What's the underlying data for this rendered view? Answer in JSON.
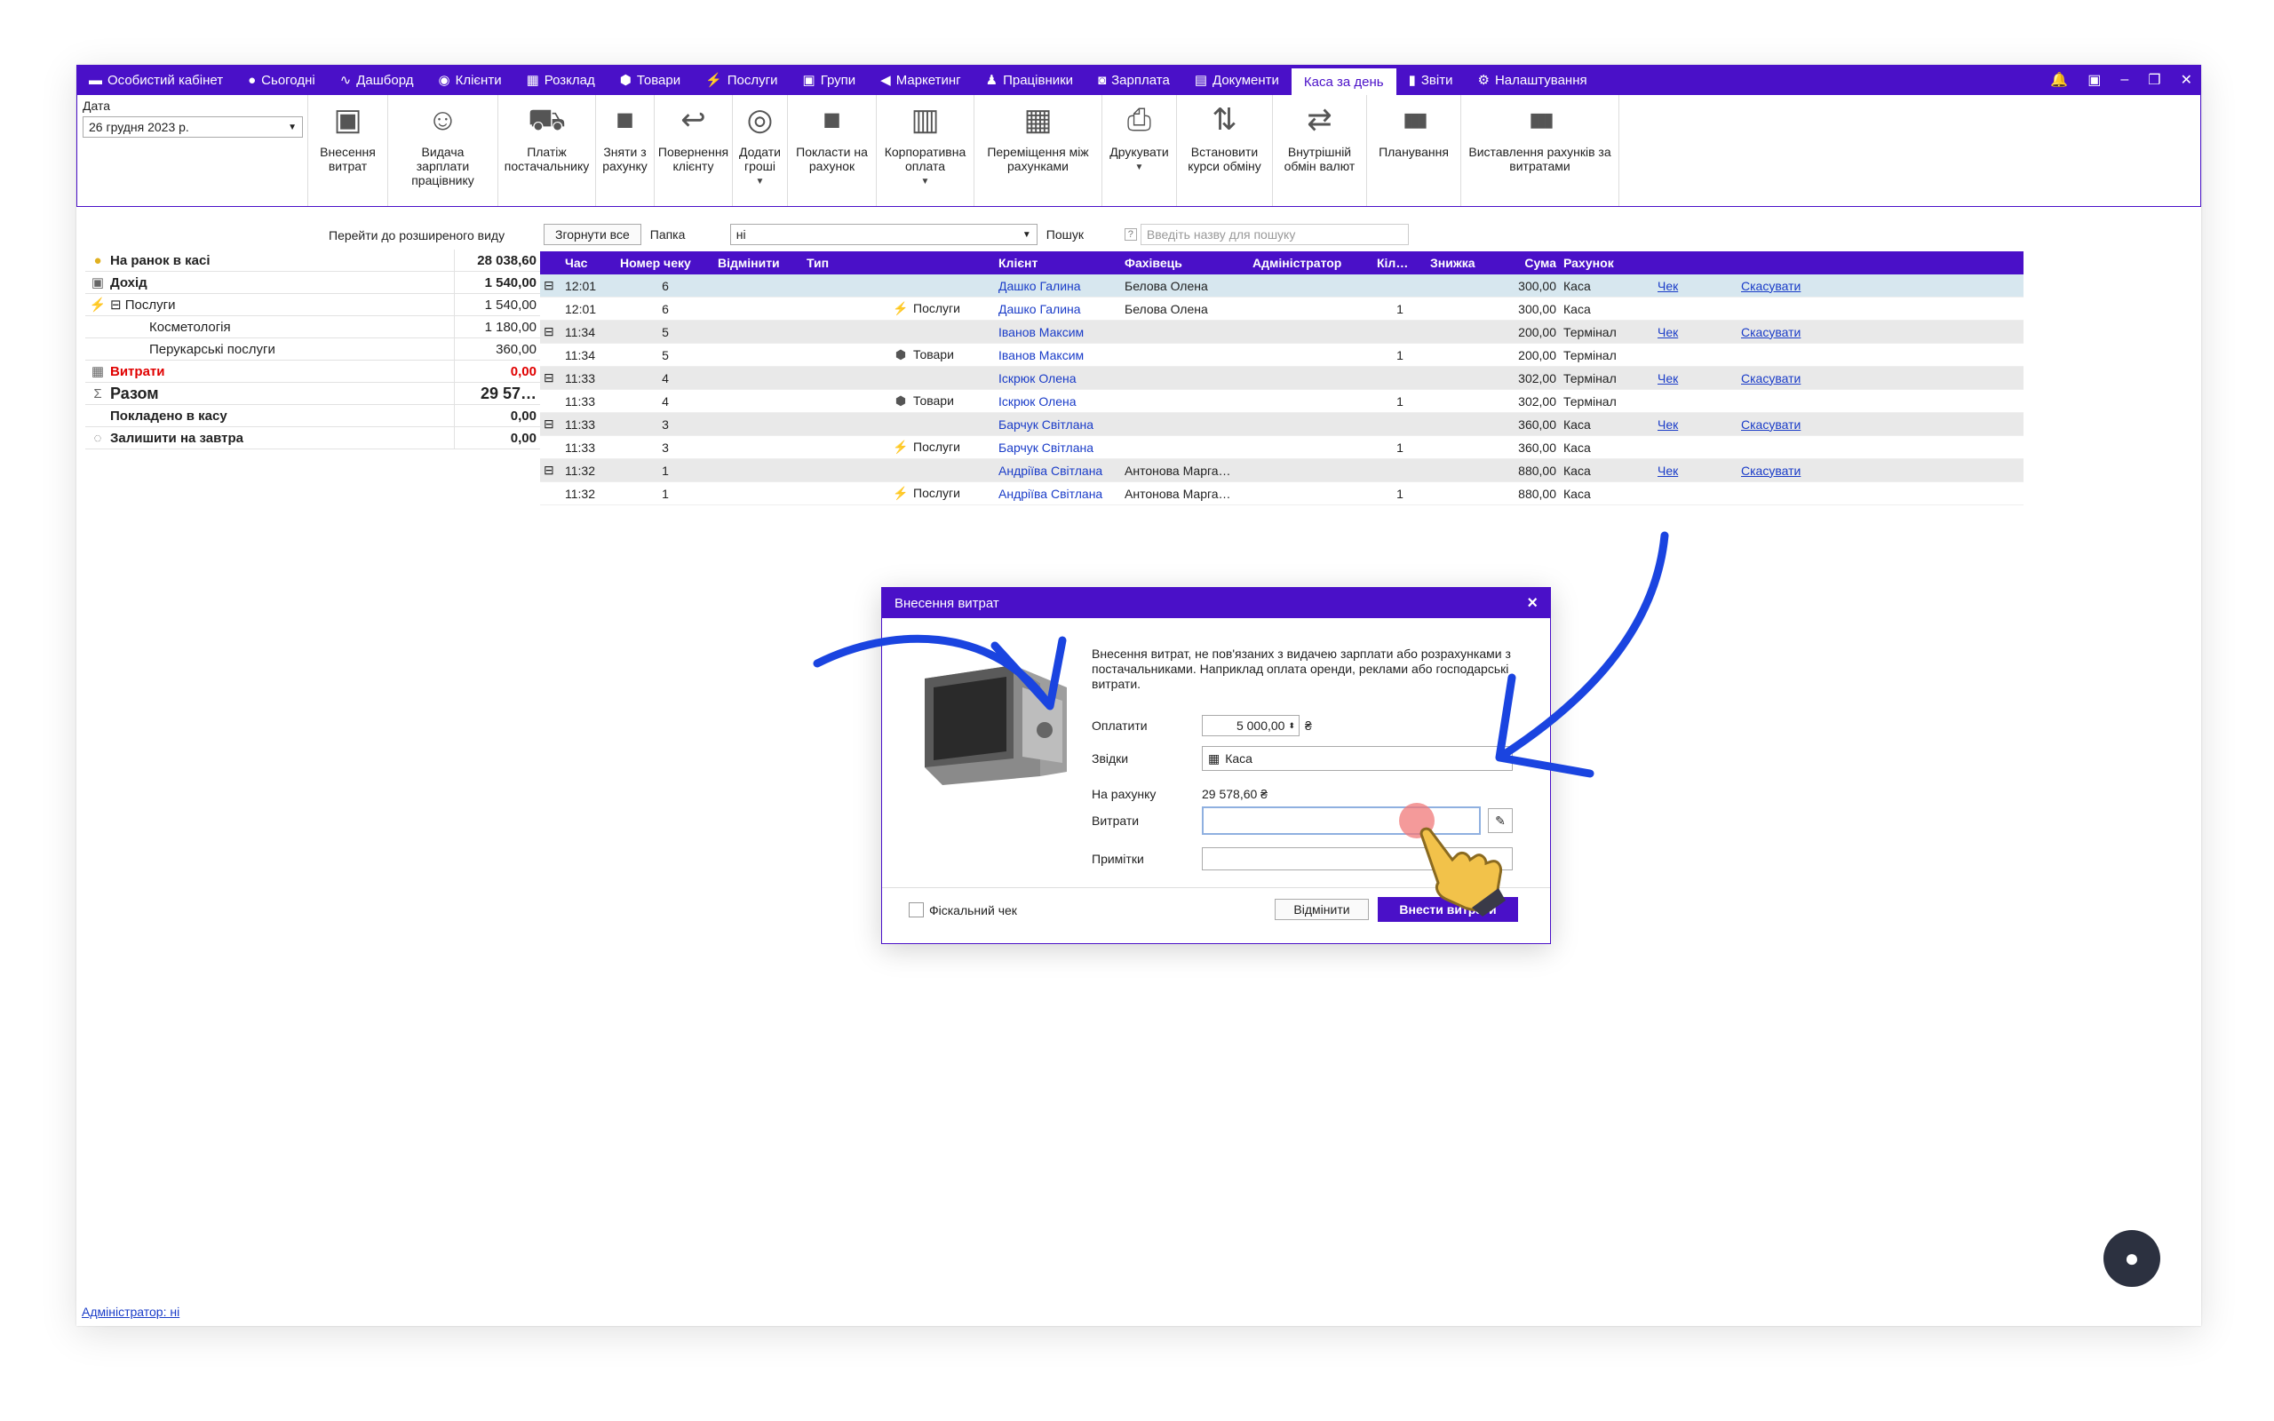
{
  "nav": {
    "tabs": [
      {
        "label": "Особистий кабінет",
        "icon": "briefcase-icon",
        "glyph": "▬"
      },
      {
        "label": "Сьогодні",
        "icon": "today-icon",
        "glyph": "●"
      },
      {
        "label": "Дашборд",
        "icon": "pulse-icon",
        "glyph": "∿"
      },
      {
        "label": "Клієнти",
        "icon": "user-circle-icon",
        "glyph": "◉"
      },
      {
        "label": "Розклад",
        "icon": "calendar-icon",
        "glyph": "▦"
      },
      {
        "label": "Товари",
        "icon": "box-icon",
        "glyph": "⬢"
      },
      {
        "label": "Послуги",
        "icon": "lightning-icon",
        "glyph": "⚡"
      },
      {
        "label": "Групи",
        "icon": "group-icon",
        "glyph": "▣"
      },
      {
        "label": "Маркетинг",
        "icon": "megaphone-icon",
        "glyph": "◀"
      },
      {
        "label": "Працівники",
        "icon": "person-icon",
        "glyph": "♟"
      },
      {
        "label": "Зарплата",
        "icon": "money-icon",
        "glyph": "◙"
      },
      {
        "label": "Документи",
        "icon": "document-icon",
        "glyph": "▤"
      },
      {
        "label": "Каса за день",
        "icon": "",
        "glyph": "",
        "active": true
      },
      {
        "label": "Звіти",
        "icon": "bar-chart-icon",
        "glyph": "▮"
      },
      {
        "label": "Налаштування",
        "icon": "gear-icon",
        "glyph": "⚙"
      }
    ]
  },
  "ribbon": {
    "date_label": "Дата",
    "date_value": "26 грудня  2023 р.",
    "buttons": [
      {
        "label": "Внесення витрат",
        "icon": "cash-icon",
        "glyph": "▣",
        "w": 90
      },
      {
        "label": "Видача зарплати працівнику",
        "icon": "worker-money-icon",
        "glyph": "☺",
        "w": 124
      },
      {
        "label": "Платіж постачальнику",
        "icon": "truck-icon",
        "glyph": "⛟",
        "w": 110
      },
      {
        "label": "Зняти з рахунку",
        "icon": "safe-icon",
        "glyph": "■",
        "w": 66
      },
      {
        "label": "Повернення клієнту",
        "icon": "refund-icon",
        "glyph": "↩",
        "w": 88
      },
      {
        "label": "Додати гроші",
        "icon": "coins-icon",
        "glyph": "◎",
        "w": 62,
        "drop": true
      },
      {
        "label": "Покласти на рахунок",
        "icon": "deposit-icon",
        "glyph": "■",
        "w": 100
      },
      {
        "label": "Корпоративна оплата",
        "icon": "building-icon",
        "glyph": "▥",
        "w": 110,
        "drop": true
      },
      {
        "label": "Переміщення між рахунками",
        "icon": "calculator-icon",
        "glyph": "▦",
        "w": 144
      },
      {
        "label": "Друкувати",
        "icon": "printer-icon",
        "glyph": "⎙",
        "w": 84,
        "drop": true
      },
      {
        "label": "Встановити курси обміну",
        "icon": "exchange-rate-icon",
        "glyph": "⇅",
        "w": 108
      },
      {
        "label": "Внутрішній обмін валют",
        "icon": "currency-exchange-icon",
        "glyph": "⇄",
        "w": 106
      },
      {
        "label": "Планування",
        "icon": "bar-chart-icon",
        "glyph": "▮▮▮",
        "w": 106
      },
      {
        "label": "Виставлення рахунків за витратами",
        "icon": "bar-chart-icon",
        "glyph": "▮▮▮",
        "w": 178
      }
    ]
  },
  "summary": {
    "expand_link": "Перейти до розширеного виду",
    "rows": [
      {
        "icon": "coin-icon",
        "glyph": "●",
        "label": "На ранок в касі",
        "value": "28 038,60",
        "cls": "bold",
        "indent": 0
      },
      {
        "icon": "cash-icon",
        "glyph": "▣",
        "label": "Дохід",
        "value": "1 540,00",
        "cls": "bold",
        "indent": 0
      },
      {
        "icon": "lightning-icon",
        "glyph": "⚡",
        "label": "⊟ Послуги",
        "value": "1 540,00",
        "cls": "",
        "indent": 0
      },
      {
        "icon": "",
        "glyph": "",
        "label": "Косметологія",
        "value": "1 180,00",
        "cls": "",
        "indent": 44
      },
      {
        "icon": "",
        "glyph": "",
        "label": "Перукарські послуги",
        "value": "360,00",
        "cls": "",
        "indent": 44
      },
      {
        "icon": "calculator-icon",
        "glyph": "▦",
        "label": "Витрати",
        "value": "0,00",
        "cls": "bold red",
        "indent": 0
      },
      {
        "icon": "sigma-icon",
        "glyph": "Σ",
        "label": "Разом",
        "value": "29 57…",
        "cls": "bold big",
        "indent": 0
      },
      {
        "icon": "",
        "glyph": "",
        "label": "Покладено в касу",
        "value": "0,00",
        "cls": "bold",
        "indent": 0
      },
      {
        "icon": "chat-bubble-icon",
        "glyph": "◌",
        "label": "Залишити на завтра",
        "value": "0,00",
        "cls": "bold",
        "indent": 0
      }
    ]
  },
  "toolbar": {
    "collapse_label": "Згорнути все",
    "folder_label": "Папка",
    "folder_value": "ні",
    "search_label": "Пошук",
    "search_placeholder": "Введіть назву для пошуку"
  },
  "grid": {
    "headers": [
      "",
      "Час",
      "Номер чеку",
      "Відмінити",
      "Тип",
      "Клієнт",
      "Фахівець",
      "Адміністратор",
      "Кіл…",
      "Знижка",
      "Сума",
      "Рахунок",
      "",
      ""
    ],
    "rows": [
      {
        "group": true,
        "sel": true,
        "time": "12:01",
        "num": "6",
        "type": "",
        "type_icon": "",
        "client": "Дашко Галина",
        "spec": "Белова Олена",
        "qty": "",
        "sum": "300,00",
        "acc": "Каса",
        "chek": "Чек",
        "skas": "Скасувати"
      },
      {
        "group": false,
        "time": "12:01",
        "num": "6",
        "type": "Послуги",
        "type_icon": "⚡",
        "client": "Дашко Галина",
        "spec": "Белова Олена",
        "qty": "1",
        "sum": "300,00",
        "acc": "Каса",
        "chek": "",
        "skas": ""
      },
      {
        "group": true,
        "time": "11:34",
        "num": "5",
        "type": "",
        "type_icon": "",
        "client": "Іванов Максим",
        "spec": "",
        "qty": "",
        "sum": "200,00",
        "acc": "Термінал",
        "chek": "Чек",
        "skas": "Скасувати"
      },
      {
        "group": false,
        "time": "11:34",
        "num": "5",
        "type": "Товари",
        "type_icon": "⬢",
        "client": "Іванов Максим",
        "spec": "",
        "qty": "1",
        "sum": "200,00",
        "acc": "Термінал",
        "chek": "",
        "skas": ""
      },
      {
        "group": true,
        "time": "11:33",
        "num": "4",
        "type": "",
        "type_icon": "",
        "client": "Іскрюк Олена",
        "spec": "",
        "qty": "",
        "sum": "302,00",
        "acc": "Термінал",
        "chek": "Чек",
        "skas": "Скасувати"
      },
      {
        "group": false,
        "time": "11:33",
        "num": "4",
        "type": "Товари",
        "type_icon": "⬢",
        "client": "Іскрюк Олена",
        "spec": "",
        "qty": "1",
        "sum": "302,00",
        "acc": "Термінал",
        "chek": "",
        "skas": ""
      },
      {
        "group": true,
        "time": "11:33",
        "num": "3",
        "type": "",
        "type_icon": "",
        "client": "Барчук Світлана",
        "spec": "",
        "qty": "",
        "sum": "360,00",
        "acc": "Каса",
        "chek": "Чек",
        "skas": "Скасувати"
      },
      {
        "group": false,
        "time": "11:33",
        "num": "3",
        "type": "Послуги",
        "type_icon": "⚡",
        "client": "Барчук Світлана",
        "spec": "",
        "qty": "1",
        "sum": "360,00",
        "acc": "Каса",
        "chek": "",
        "skas": ""
      },
      {
        "group": true,
        "time": "11:32",
        "num": "1",
        "type": "",
        "type_icon": "",
        "client": "Андріїва Світлана",
        "spec": "Антонова Марга…",
        "qty": "",
        "sum": "880,00",
        "acc": "Каса",
        "chek": "Чек",
        "skas": "Скасувати"
      },
      {
        "group": false,
        "time": "11:32",
        "num": "1",
        "type": "Послуги",
        "type_icon": "⚡",
        "client": "Андріїва Світлана",
        "spec": "Антонова Марга…",
        "qty": "1",
        "sum": "880,00",
        "acc": "Каса",
        "chek": "",
        "skas": ""
      }
    ]
  },
  "dialog": {
    "title": "Внесення витрат",
    "description": "Внесення витрат, не пов'язаних з видачею зарплати або розрахунками з постачальниками. Наприклад оплата оренди, реклами або господарські витрати.",
    "pay_label": "Оплатити",
    "pay_value": "5 000,00",
    "currency": "₴",
    "from_label": "Звідки",
    "from_value": "Каса",
    "balance_label": "На рахунку",
    "balance_value": "29 578,60 ₴",
    "expense_label": "Витрати",
    "expense_value": "",
    "notes_label": "Примітки",
    "notes_value": "",
    "fiscal_label": "Фіскальний чек",
    "cancel_label": "Відмінити",
    "submit_label": "Внести витрати"
  },
  "status": {
    "admin": "Адміністратор: ні"
  },
  "colors": {
    "accent": "#4a10c8",
    "link": "#1a3cc8",
    "danger": "#e00000",
    "arrow": "#1a44e0"
  }
}
